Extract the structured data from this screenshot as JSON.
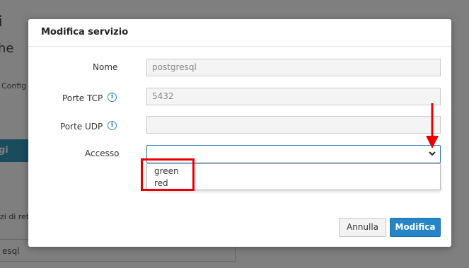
{
  "background": {
    "heading_fragment": "i",
    "subheading_fragment": "he",
    "small_fragment": "Config",
    "button_fragment": "gi serv",
    "label_fragment": "zi di ret",
    "input_fragment": "esql"
  },
  "modal": {
    "title": "Modifica servizio",
    "fields": {
      "name": {
        "label": "Nome",
        "value": "postgresql"
      },
      "tcp": {
        "label": "Porte TCP",
        "value": "5432"
      },
      "udp": {
        "label": "Porte UDP",
        "value": ""
      },
      "access": {
        "label": "Accesso",
        "selected": ""
      }
    },
    "access_options": [
      "green",
      "red"
    ],
    "buttons": {
      "cancel": "Annulla",
      "submit": "Modifica"
    }
  },
  "icons": {
    "info": "info-circle-icon",
    "chevron": "chevron-down-icon"
  },
  "colors": {
    "primary": "#2585c9",
    "annotation": "#e80000"
  }
}
